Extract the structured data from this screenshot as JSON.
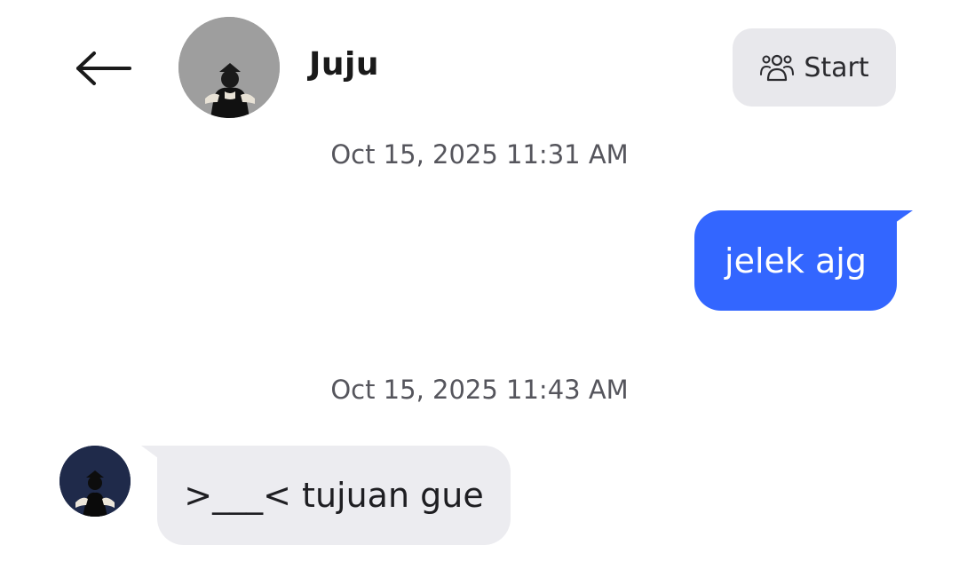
{
  "header": {
    "back_icon": "arrow-left-icon",
    "contact_name": "Juju",
    "start_button": {
      "label": "Start",
      "icon": "group-icon"
    }
  },
  "messages": [
    {
      "timestamp": "Oct 15, 2025 11:31 AM",
      "direction": "outgoing",
      "text": "jelek ajg",
      "bubble_color": "#3366ff"
    },
    {
      "timestamp": "Oct 15, 2025 11:43 AM",
      "direction": "incoming",
      "text": ">___< tujuan gue",
      "bubble_color": "#ececf0"
    }
  ]
}
